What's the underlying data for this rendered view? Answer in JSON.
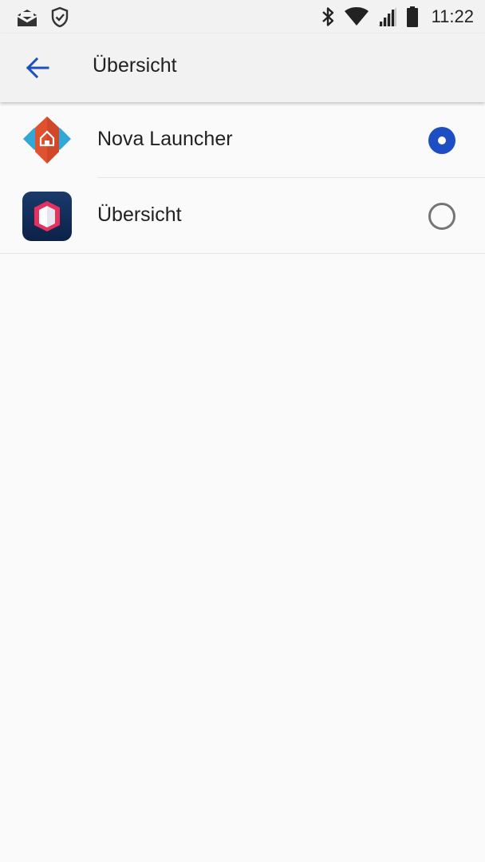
{
  "status_bar": {
    "time": "11:22",
    "icons_left": [
      "mail-icon",
      "shield-check-icon"
    ],
    "icons_right": [
      "bluetooth-icon",
      "wifi-icon",
      "cell-signal-icon",
      "battery-icon"
    ]
  },
  "app_bar": {
    "back_icon": "arrow-back-icon",
    "title": "Übersicht"
  },
  "options": [
    {
      "label": "Nova Launcher",
      "icon": "nova-launcher-icon",
      "selected": true
    },
    {
      "label": "Übersicht",
      "icon": "uebersicht-app-icon",
      "selected": false
    }
  ],
  "colors": {
    "accent": "#1e4fc2",
    "background": "#fafafa",
    "app_bar": "#f2f2f2",
    "radio_unchecked": "#757575"
  }
}
